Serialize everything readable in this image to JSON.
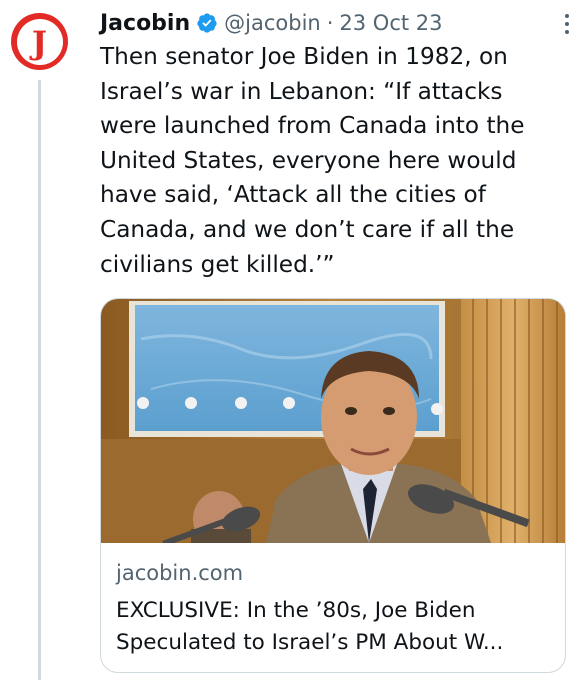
{
  "tweet": {
    "author": {
      "display_name": "Jacobin",
      "handle": "@jacobin",
      "avatar_letter": "J",
      "verified": true,
      "brand_color": "#e22b26",
      "verified_color": "#1d9bf0"
    },
    "separator": "·",
    "date": "23 Oct 23",
    "text": "Then senator Joe Biden in 1982, on\nIsrael’s war in Lebanon: “If attacks\nwere launched from Canada into the\nUnited States, everyone here would\nhave said, ‘Attack all the cities of\nCanada, and we don’t care if all the\ncivilians get killed.’”",
    "more_icon": "more-dots-icon",
    "card": {
      "domain": "jacobin.com",
      "title": "EXCLUSIVE: In the ’80s, Joe Biden Speculated to Israel’s PM About W..."
    }
  }
}
